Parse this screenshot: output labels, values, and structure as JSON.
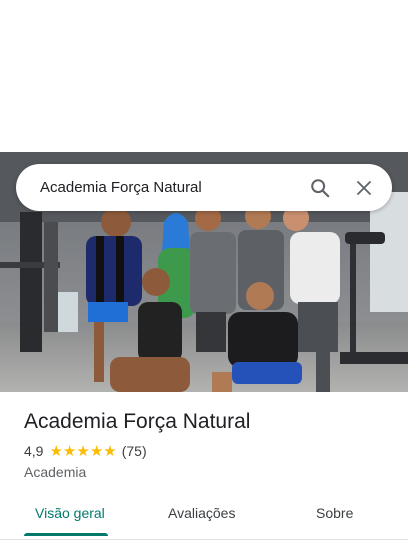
{
  "search": {
    "query": "Academia Força Natural"
  },
  "icons": {
    "search": "search-icon",
    "close": "close-icon",
    "star": "star-icon"
  },
  "place": {
    "name": "Academia Força Natural",
    "rating": "4,9",
    "stars": 5,
    "review_count": "(75)",
    "category": "Academia"
  },
  "tabs": [
    {
      "label": "Visão geral",
      "active": true
    },
    {
      "label": "Avaliações",
      "active": false
    },
    {
      "label": "Sobre",
      "active": false
    }
  ],
  "colors": {
    "accent": "#00796b",
    "star": "#fbbc04",
    "text": "#202124",
    "secondary": "#5f6368"
  }
}
